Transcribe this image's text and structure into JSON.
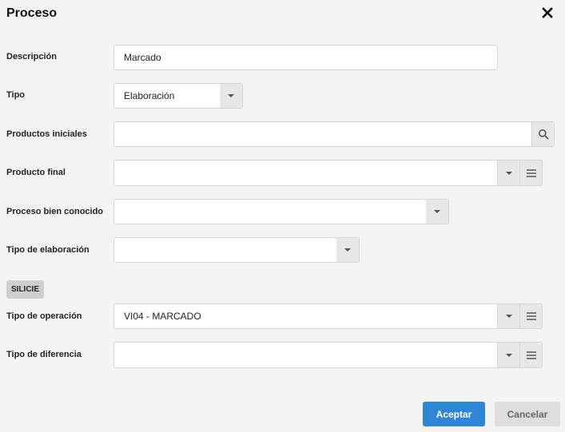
{
  "dialog": {
    "title": "Proceso"
  },
  "form": {
    "descripcion": {
      "label": "Descripción",
      "value": "Marcado"
    },
    "tipo": {
      "label": "Tipo",
      "value": "Elaboración"
    },
    "productos_iniciales": {
      "label": "Productos iniciales",
      "value": ""
    },
    "producto_final": {
      "label": "Producto final",
      "value": ""
    },
    "proceso_bien_conocido": {
      "label": "Proceso bien conocido",
      "value": ""
    },
    "tipo_elaboracion": {
      "label": "Tipo de elaboración",
      "value": ""
    },
    "section_silicie": {
      "label": "SILICIE"
    },
    "tipo_operacion": {
      "label": "Tipo de operación",
      "value": "VI04 - MARCADO"
    },
    "tipo_diferencia": {
      "label": "Tipo de diferencia",
      "value": ""
    }
  },
  "footer": {
    "accept_label": "Aceptar",
    "cancel_label": "Cancelar"
  },
  "icons": {
    "close": "close-icon",
    "search": "search-icon",
    "dropdown": "chevron-down-icon",
    "list": "list-icon"
  },
  "colors": {
    "primary": "#2f86d6",
    "background": "#f4f4f4",
    "field_border": "#d4d4d4",
    "button_grey": "#e7e7e7"
  }
}
